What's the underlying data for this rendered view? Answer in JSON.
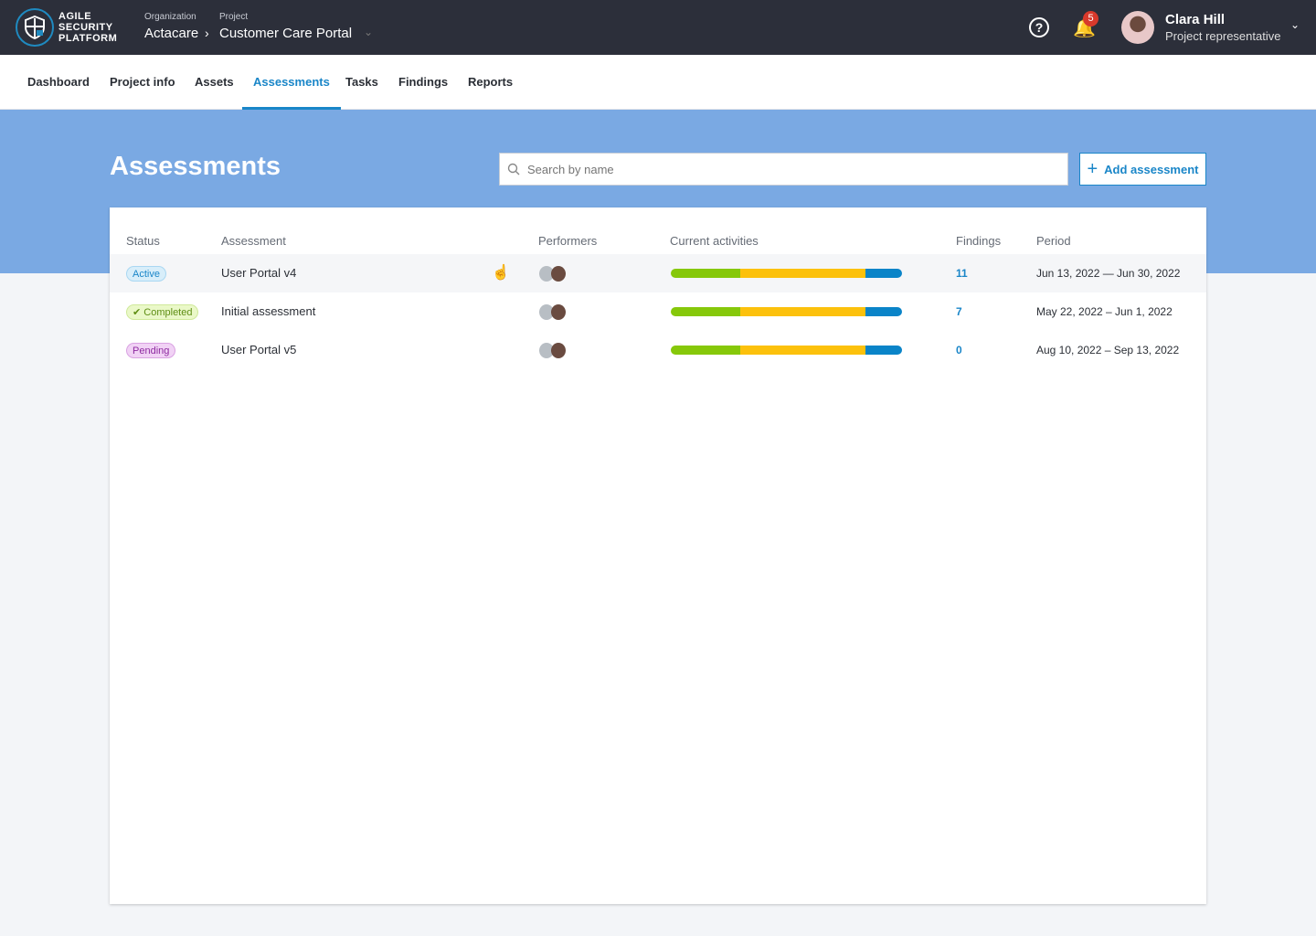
{
  "brand": {
    "line1": "AGILE",
    "line2": "SECURITY",
    "line3": "PLATFORM"
  },
  "breadcrumb": {
    "org_label": "Organization",
    "org": "Actacare",
    "project_label": "Project",
    "project": "Customer Care Portal"
  },
  "notifications": {
    "count": "5"
  },
  "user": {
    "name": "Clara Hill",
    "role": "Project representative"
  },
  "nav": {
    "tabs": [
      {
        "label": "Dashboard"
      },
      {
        "label": "Project info"
      },
      {
        "label": "Assets"
      },
      {
        "label": "Assessments",
        "active": true
      },
      {
        "label": "Tasks"
      },
      {
        "label": "Findings"
      },
      {
        "label": "Reports"
      }
    ]
  },
  "page": {
    "title": "Assessments",
    "search_placeholder": "Search by name",
    "add_label": "Add assessment"
  },
  "colors": {
    "accent": "#1a86c8",
    "hero": "#7aa9e3",
    "bar_green": "#86c80a",
    "bar_yellow": "#fcc10c",
    "bar_blue": "#0a84c8"
  },
  "table": {
    "headers": {
      "status": "Status",
      "assessment": "Assessment",
      "performers": "Performers",
      "activities": "Current activities",
      "findings": "Findings",
      "period": "Period"
    },
    "rows": [
      {
        "status": "Active",
        "name": "User Portal v4",
        "findings": "11",
        "period": "Jun 13, 2022 — Jun 30, 2022",
        "activities_pct": [
          30,
          54,
          16
        ]
      },
      {
        "status": "Completed",
        "name": "Initial assessment",
        "findings": "7",
        "period": "May 22, 2022 – Jun 1, 2022",
        "activities_pct": [
          30,
          54,
          16
        ]
      },
      {
        "status": "Pending",
        "name": "User Portal v5",
        "findings": "0",
        "period": "Aug 10, 2022 – Sep 13, 2022",
        "activities_pct": [
          30,
          54,
          16
        ]
      }
    ]
  }
}
